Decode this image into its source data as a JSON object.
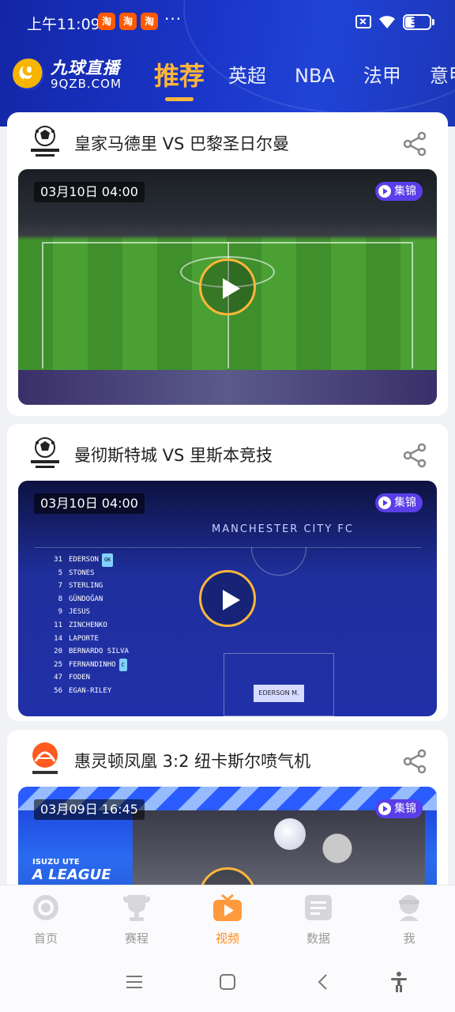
{
  "status_bar": {
    "time": "上午11:09",
    "notif_icon_glyph": "淘",
    "more": "···",
    "battery": "38"
  },
  "brand": {
    "name_cn": "九球直播",
    "name_en": "9QZB.COM",
    "mark": "9"
  },
  "tabs": [
    {
      "label": "推荐",
      "active": true
    },
    {
      "label": "英超"
    },
    {
      "label": "NBA"
    },
    {
      "label": "法甲"
    },
    {
      "label": "意甲"
    }
  ],
  "cards": [
    {
      "title": "皇家马德里 VS 巴黎圣日尔曼",
      "league": "champions-league",
      "date": "03月10日 04:00",
      "badge": "集锦"
    },
    {
      "title": "曼彻斯特城 VS 里斯本竞技",
      "league": "champions-league",
      "date": "03月10日 04:00",
      "badge": "集锦",
      "lineup": {
        "club": "MANCHESTER CITY FC",
        "plate": "EDERSON M.",
        "players": [
          {
            "num": "31",
            "name": "EDERSON",
            "tag": "GK"
          },
          {
            "num": "5",
            "name": "STONES"
          },
          {
            "num": "7",
            "name": "STERLING"
          },
          {
            "num": "8",
            "name": "GÜNDOĞAN"
          },
          {
            "num": "9",
            "name": "JESUS"
          },
          {
            "num": "11",
            "name": "ZINCHENKO"
          },
          {
            "num": "14",
            "name": "LAPORTE"
          },
          {
            "num": "20",
            "name": "BERNARDO SILVA"
          },
          {
            "num": "25",
            "name": "FERNANDINHO",
            "tag": "C"
          },
          {
            "num": "47",
            "name": "FODEN"
          },
          {
            "num": "56",
            "name": "EGAN-RILEY"
          }
        ]
      }
    },
    {
      "title": "惠灵顿凤凰 3:2 纽卡斯尔喷气机",
      "league": "a-league",
      "date": "03月09日 16:45",
      "badge": "集锦",
      "overlay_brand": "ISUZU UTE",
      "overlay_league": "A LEAGUE"
    }
  ],
  "bottom_nav": [
    {
      "label": "首页",
      "icon": "home-icon"
    },
    {
      "label": "赛程",
      "icon": "trophy-icon"
    },
    {
      "label": "视频",
      "icon": "video-icon",
      "active": true
    },
    {
      "label": "数据",
      "icon": "data-icon"
    },
    {
      "label": "我",
      "icon": "profile-icon"
    }
  ],
  "colors": {
    "header": "#1a36c8",
    "accent": "#ffb63a",
    "nav_active": "#ff8a1f",
    "highlight_badge": "#5a3ee8"
  }
}
